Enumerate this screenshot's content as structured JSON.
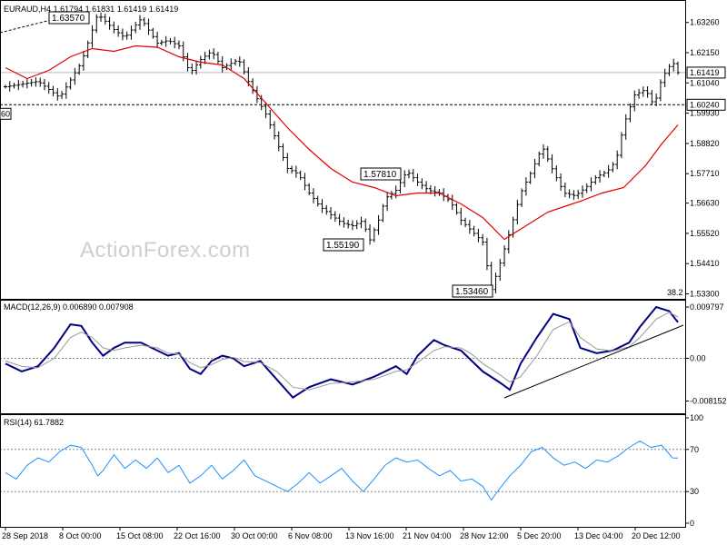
{
  "chart_data": [
    {
      "type": "candlestick",
      "symbol": "EURAUD",
      "timeframe": "H4",
      "ohlc": {
        "open": "1.61794",
        "high": "1.61831",
        "low": "1.61419",
        "close": "1.61419"
      },
      "watermark": "ActionForex.com",
      "y_ticks": [
        "1.63260",
        "1.62150",
        "1.61040",
        "1.59930",
        "1.58820",
        "1.57710",
        "1.56630",
        "1.55520",
        "1.54410",
        "1.53300"
      ],
      "x_ticks": [
        "28 Sep 2018",
        "8 Oct 00:00",
        "15 Oct 08:00",
        "22 Oct 16:00",
        "30 Oct 00:00",
        "6 Nov 08:00",
        "13 Nov 16:00",
        "21 Nov 04:00",
        "28 Nov 12:00",
        "5 Dec 20:00",
        "13 Dec 04:00",
        "20 Dec 12:00"
      ],
      "ylim": [
        1.5325,
        1.6395
      ],
      "current_price": "1.61419",
      "hline_level": "1.60240",
      "fib_label": "38.2",
      "left_level_label": "60",
      "annotations": [
        {
          "label": "1.63570",
          "value": 1.6357
        },
        {
          "label": "1.55190",
          "value": 1.5519
        },
        {
          "label": "1.57810",
          "value": 1.5781
        },
        {
          "label": "1.53460",
          "value": 1.5346
        }
      ],
      "price_path": [
        [
          0,
          1.609
        ],
        [
          3,
          1.611
        ],
        [
          5,
          1.605
        ],
        [
          7,
          1.618
        ],
        [
          8.5,
          1.6357
        ],
        [
          10,
          1.63
        ],
        [
          11,
          1.627
        ],
        [
          12.5,
          1.634
        ],
        [
          14,
          1.625
        ],
        [
          15,
          1.626
        ],
        [
          16,
          1.624
        ],
        [
          17,
          1.614
        ],
        [
          18,
          1.619
        ],
        [
          19,
          1.622
        ],
        [
          20,
          1.616
        ],
        [
          21.5,
          1.619
        ],
        [
          22.5,
          1.61
        ],
        [
          23,
          1.606
        ],
        [
          24,
          1.599
        ],
        [
          25,
          1.589
        ],
        [
          26,
          1.579
        ],
        [
          27,
          1.577
        ],
        [
          28,
          1.57
        ],
        [
          29,
          1.565
        ],
        [
          30,
          1.562
        ],
        [
          31,
          1.559
        ],
        [
          32,
          1.558
        ],
        [
          33,
          1.56
        ],
        [
          33.5,
          1.5519
        ],
        [
          34.5,
          1.561
        ],
        [
          35,
          1.568
        ],
        [
          36,
          1.571
        ],
        [
          37,
          1.5781
        ],
        [
          38,
          1.574
        ],
        [
          39,
          1.571
        ],
        [
          40,
          1.57
        ],
        [
          41,
          1.567
        ],
        [
          42,
          1.56
        ],
        [
          43,
          1.556
        ],
        [
          44,
          1.552
        ],
        [
          44.8,
          1.5346
        ],
        [
          45.5,
          1.543
        ],
        [
          46.5,
          1.556
        ],
        [
          47.5,
          1.57
        ],
        [
          48.5,
          1.578
        ],
        [
          49.5,
          1.587
        ],
        [
          50.5,
          1.578
        ],
        [
          51.5,
          1.57
        ],
        [
          52.5,
          1.569
        ],
        [
          53.5,
          1.572
        ],
        [
          54.5,
          1.576
        ],
        [
          55.5,
          1.578
        ],
        [
          56.3,
          1.582
        ],
        [
          57,
          1.595
        ],
        [
          58,
          1.606
        ],
        [
          59,
          1.608
        ],
        [
          59.8,
          1.602
        ],
        [
          60.5,
          1.612
        ],
        [
          61.5,
          1.6183
        ],
        [
          62,
          1.6142
        ]
      ],
      "ma_path": [
        [
          0,
          1.616
        ],
        [
          2,
          1.612
        ],
        [
          4,
          1.615
        ],
        [
          6,
          1.62
        ],
        [
          8,
          1.623
        ],
        [
          10,
          1.622
        ],
        [
          12,
          1.624
        ],
        [
          14,
          1.6235
        ],
        [
          16,
          1.62
        ],
        [
          18,
          1.618
        ],
        [
          20,
          1.617
        ],
        [
          22,
          1.612
        ],
        [
          24,
          1.603
        ],
        [
          26,
          1.594
        ],
        [
          28,
          1.586
        ],
        [
          30,
          1.579
        ],
        [
          32,
          1.574
        ],
        [
          34,
          1.572
        ],
        [
          36,
          1.569
        ],
        [
          38,
          1.57
        ],
        [
          40,
          1.57
        ],
        [
          42,
          1.566
        ],
        [
          44,
          1.561
        ],
        [
          46,
          1.553
        ],
        [
          48,
          1.558
        ],
        [
          50,
          1.563
        ],
        [
          51.5,
          1.565
        ],
        [
          53,
          1.567
        ],
        [
          55,
          1.57
        ],
        [
          57,
          1.572
        ],
        [
          59,
          1.58
        ],
        [
          60.5,
          1.588
        ],
        [
          62,
          1.595
        ]
      ]
    },
    {
      "type": "line",
      "title": "MACD(12,26,9) 0.006890 0.007908",
      "y_ticks": [
        "0.009797",
        "0.00",
        "-0.008152"
      ],
      "ylim": [
        -0.0098,
        0.0105
      ],
      "macd": [
        [
          0,
          -0.001
        ],
        [
          1.5,
          -0.0025
        ],
        [
          3,
          -0.0015
        ],
        [
          4.5,
          0.002
        ],
        [
          6,
          0.0065
        ],
        [
          7,
          0.0062
        ],
        [
          8,
          0.003
        ],
        [
          9,
          0.0005
        ],
        [
          10,
          0.002
        ],
        [
          11,
          0.003
        ],
        [
          12.5,
          0.003
        ],
        [
          14,
          0.0015
        ],
        [
          15,
          0.0005
        ],
        [
          16,
          0.001
        ],
        [
          17,
          -0.002
        ],
        [
          18,
          -0.003
        ],
        [
          19,
          -0.0005
        ],
        [
          20,
          0.0005
        ],
        [
          21,
          0.0
        ],
        [
          22,
          -0.0015
        ],
        [
          23.5,
          -0.0005
        ],
        [
          25,
          -0.004
        ],
        [
          26.5,
          -0.0075
        ],
        [
          28,
          -0.0055
        ],
        [
          30,
          -0.004
        ],
        [
          32,
          -0.005
        ],
        [
          34,
          -0.0035
        ],
        [
          36,
          -0.0015
        ],
        [
          37,
          -0.003
        ],
        [
          38,
          0.0005
        ],
        [
          39.5,
          0.0035
        ],
        [
          40.5,
          0.0025
        ],
        [
          42,
          0.0015
        ],
        [
          43,
          -0.0005
        ],
        [
          44,
          -0.0025
        ],
        [
          45.5,
          -0.0045
        ],
        [
          46.5,
          -0.006
        ],
        [
          47.5,
          -0.001
        ],
        [
          49,
          0.004
        ],
        [
          50.5,
          0.0085
        ],
        [
          52,
          0.0075
        ],
        [
          53,
          0.002
        ],
        [
          54.5,
          0.001
        ],
        [
          56,
          0.0015
        ],
        [
          57.5,
          0.003
        ],
        [
          58.5,
          0.006
        ],
        [
          60,
          0.0098
        ],
        [
          61.2,
          0.009
        ],
        [
          62,
          0.0069
        ]
      ],
      "signal": [
        [
          0,
          -0.0005
        ],
        [
          1.5,
          -0.0015
        ],
        [
          3,
          -0.0018
        ],
        [
          4.5,
          0.0
        ],
        [
          6,
          0.004
        ],
        [
          7,
          0.005
        ],
        [
          8,
          0.004
        ],
        [
          9,
          0.002
        ],
        [
          10,
          0.0015
        ],
        [
          11,
          0.002
        ],
        [
          12.5,
          0.0025
        ],
        [
          14,
          0.002
        ],
        [
          15,
          0.001
        ],
        [
          16,
          0.0008
        ],
        [
          17,
          -0.0008
        ],
        [
          18,
          -0.0018
        ],
        [
          19,
          -0.0012
        ],
        [
          20,
          -0.0002
        ],
        [
          21,
          0.0002
        ],
        [
          22,
          -0.0006
        ],
        [
          23.5,
          -0.0008
        ],
        [
          25,
          -0.0025
        ],
        [
          26.5,
          -0.0055
        ],
        [
          28,
          -0.006
        ],
        [
          30,
          -0.0048
        ],
        [
          32,
          -0.0045
        ],
        [
          34,
          -0.004
        ],
        [
          36,
          -0.0025
        ],
        [
          37,
          -0.0022
        ],
        [
          38,
          -0.0008
        ],
        [
          39.5,
          0.0015
        ],
        [
          40.5,
          0.0022
        ],
        [
          42,
          0.002
        ],
        [
          43,
          0.0008
        ],
        [
          44,
          -0.001
        ],
        [
          45.5,
          -0.003
        ],
        [
          46.5,
          -0.0045
        ],
        [
          47.5,
          -0.0035
        ],
        [
          49,
          0.0005
        ],
        [
          50.5,
          0.0055
        ],
        [
          52,
          0.007
        ],
        [
          53,
          0.004
        ],
        [
          54.5,
          0.0018
        ],
        [
          56,
          0.0014
        ],
        [
          57.5,
          0.0022
        ],
        [
          58.5,
          0.004
        ],
        [
          60,
          0.0075
        ],
        [
          61.2,
          0.0088
        ],
        [
          62,
          0.0079
        ]
      ]
    },
    {
      "type": "line",
      "title": "RSI(14) 61.7882",
      "y_ticks": [
        "100",
        "70",
        "30",
        "0"
      ],
      "ylim": [
        0,
        100
      ],
      "rsi": [
        [
          0,
          48
        ],
        [
          1,
          42
        ],
        [
          2,
          55
        ],
        [
          3,
          62
        ],
        [
          4,
          58
        ],
        [
          5,
          68
        ],
        [
          6,
          74
        ],
        [
          7,
          72
        ],
        [
          8,
          55
        ],
        [
          8.5,
          45
        ],
        [
          9,
          50
        ],
        [
          10,
          65
        ],
        [
          11,
          52
        ],
        [
          12,
          60
        ],
        [
          13,
          52
        ],
        [
          14,
          62
        ],
        [
          15,
          48
        ],
        [
          16,
          55
        ],
        [
          17,
          38
        ],
        [
          18,
          45
        ],
        [
          19,
          55
        ],
        [
          20,
          42
        ],
        [
          21,
          50
        ],
        [
          22,
          60
        ],
        [
          23,
          45
        ],
        [
          24,
          40
        ],
        [
          25,
          35
        ],
        [
          26,
          30
        ],
        [
          27,
          38
        ],
        [
          28,
          48
        ],
        [
          29,
          38
        ],
        [
          30,
          45
        ],
        [
          31,
          52
        ],
        [
          32,
          40
        ],
        [
          33,
          30
        ],
        [
          34,
          42
        ],
        [
          35,
          55
        ],
        [
          36,
          62
        ],
        [
          37,
          58
        ],
        [
          38,
          60
        ],
        [
          39,
          52
        ],
        [
          40,
          45
        ],
        [
          41,
          50
        ],
        [
          42,
          40
        ],
        [
          43,
          42
        ],
        [
          44,
          35
        ],
        [
          44.8,
          22
        ],
        [
          45.5,
          32
        ],
        [
          46.5,
          45
        ],
        [
          47.5,
          55
        ],
        [
          48.5,
          68
        ],
        [
          49.5,
          72
        ],
        [
          50.5,
          62
        ],
        [
          51.5,
          55
        ],
        [
          52.5,
          58
        ],
        [
          53.5,
          52
        ],
        [
          54.5,
          60
        ],
        [
          55.5,
          58
        ],
        [
          56.5,
          64
        ],
        [
          57.5,
          72
        ],
        [
          58.5,
          78
        ],
        [
          59.5,
          72
        ],
        [
          60.5,
          74
        ],
        [
          61.5,
          62
        ],
        [
          62,
          61.8
        ]
      ]
    }
  ]
}
